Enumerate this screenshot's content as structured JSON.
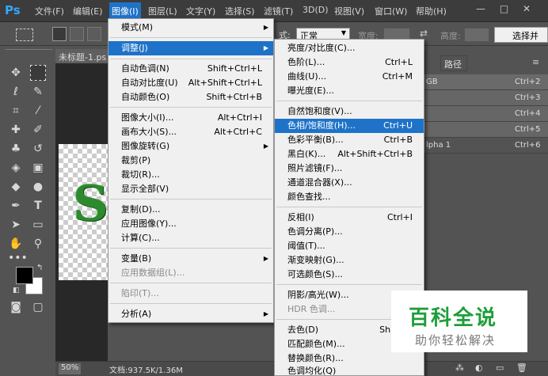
{
  "app": {
    "logo": "Ps"
  },
  "menubar": {
    "items": [
      "文件(F)",
      "编辑(E)",
      "图像(I)",
      "图层(L)",
      "文字(Y)",
      "选择(S)",
      "滤镜(T)",
      "3D(D)",
      "视图(V)",
      "窗口(W)",
      "帮助(H)"
    ]
  },
  "options": {
    "style_value": "正常",
    "width_label": "宽度:",
    "height_label": "高度:",
    "select_mask_label": "选择并"
  },
  "document": {
    "tab_title": "未标题-1.ps",
    "canvas_letter": "S",
    "zoom": "50%",
    "doc_info": "文档:937.5K/1.36M"
  },
  "panel": {
    "tab": "路径",
    "channels": [
      {
        "name": "GB",
        "shortcut": "Ctrl+2"
      },
      {
        "name": "",
        "shortcut": "Ctrl+3"
      },
      {
        "name": "",
        "shortcut": "Ctrl+4"
      },
      {
        "name": "",
        "shortcut": "Ctrl+5"
      },
      {
        "name": "lpha 1",
        "shortcut": "Ctrl+6"
      }
    ]
  },
  "image_menu": {
    "items": [
      {
        "label": "模式(M)",
        "shortcut": "",
        "submenu": true
      },
      {
        "label": "调整(J)",
        "shortcut": "",
        "submenu": true,
        "highlighted": true
      },
      {
        "label": "自动色调(N)",
        "shortcut": "Shift+Ctrl+L"
      },
      {
        "label": "自动对比度(U)",
        "shortcut": "Alt+Shift+Ctrl+L"
      },
      {
        "label": "自动颜色(O)",
        "shortcut": "Shift+Ctrl+B"
      },
      {
        "label": "图像大小(I)...",
        "shortcut": "Alt+Ctrl+I"
      },
      {
        "label": "画布大小(S)...",
        "shortcut": "Alt+Ctrl+C"
      },
      {
        "label": "图像旋转(G)",
        "shortcut": "",
        "submenu": true
      },
      {
        "label": "裁剪(P)",
        "shortcut": ""
      },
      {
        "label": "裁切(R)...",
        "shortcut": ""
      },
      {
        "label": "显示全部(V)",
        "shortcut": ""
      },
      {
        "label": "复制(D)...",
        "shortcut": ""
      },
      {
        "label": "应用图像(Y)...",
        "shortcut": ""
      },
      {
        "label": "计算(C)...",
        "shortcut": ""
      },
      {
        "label": "变量(B)",
        "shortcut": "",
        "submenu": true
      },
      {
        "label": "应用数据组(L)...",
        "shortcut": "",
        "disabled": true
      },
      {
        "label": "陷印(T)...",
        "shortcut": "",
        "disabled": true
      },
      {
        "label": "分析(A)",
        "shortcut": "",
        "submenu": true
      }
    ]
  },
  "adjust_menu": {
    "items": [
      {
        "label": "亮度/对比度(C)...",
        "shortcut": ""
      },
      {
        "label": "色阶(L)...",
        "shortcut": "Ctrl+L"
      },
      {
        "label": "曲线(U)...",
        "shortcut": "Ctrl+M"
      },
      {
        "label": "曝光度(E)...",
        "shortcut": ""
      },
      {
        "label": "自然饱和度(V)...",
        "shortcut": ""
      },
      {
        "label": "色相/饱和度(H)...",
        "shortcut": "Ctrl+U",
        "highlighted": true
      },
      {
        "label": "色彩平衡(B)...",
        "shortcut": "Ctrl+B"
      },
      {
        "label": "黑白(K)...",
        "shortcut": "Alt+Shift+Ctrl+B"
      },
      {
        "label": "照片滤镜(F)...",
        "shortcut": ""
      },
      {
        "label": "通道混合器(X)...",
        "shortcut": ""
      },
      {
        "label": "颜色查找...",
        "shortcut": ""
      },
      {
        "label": "反相(I)",
        "shortcut": "Ctrl+I"
      },
      {
        "label": "色调分离(P)...",
        "shortcut": ""
      },
      {
        "label": "阈值(T)...",
        "shortcut": ""
      },
      {
        "label": "渐变映射(G)...",
        "shortcut": ""
      },
      {
        "label": "可选颜色(S)...",
        "shortcut": ""
      },
      {
        "label": "阴影/高光(W)...",
        "shortcut": ""
      },
      {
        "label": "HDR 色调...",
        "shortcut": "",
        "disabled": true
      },
      {
        "label": "去色(D)",
        "shortcut": "Shift+C"
      },
      {
        "label": "匹配颜色(M)...",
        "shortcut": ""
      },
      {
        "label": "替换颜色(R)...",
        "shortcut": ""
      },
      {
        "label": "色调均化(Q)",
        "shortcut": ""
      }
    ]
  },
  "watermark": {
    "title": "百科全说",
    "subtitle": "助你轻松解决"
  }
}
